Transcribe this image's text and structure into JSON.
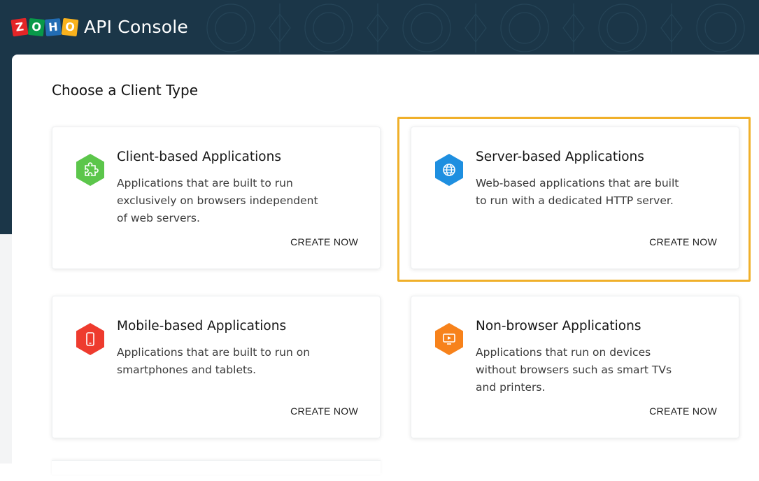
{
  "header": {
    "logo_letters": [
      "Z",
      "O",
      "H",
      "O"
    ],
    "logo_colors": [
      "#e42527",
      "#089949",
      "#226db4",
      "#f9b21d"
    ],
    "title": "API Console"
  },
  "main": {
    "section_title": "Choose a Client Type",
    "cards": [
      {
        "title": "Client-based Applications",
        "description": "Applications that are built to run exclusively on browsers independent of web servers.",
        "action": "CREATE NOW",
        "icon": "puzzle-icon",
        "color": "#5cc64b"
      },
      {
        "title": "Server-based Applications",
        "description": "Web-based applications that are built to run with a dedicated HTTP server.",
        "action": "CREATE NOW",
        "icon": "globe-icon",
        "color": "#1e8fe0",
        "highlighted": true
      },
      {
        "title": "Mobile-based Applications",
        "description": "Applications that are built to run on smartphones and tablets.",
        "action": "CREATE NOW",
        "icon": "smartphone-icon",
        "color": "#ee3b2e"
      },
      {
        "title": "Non-browser Applications",
        "description": "Applications that run on devices without browsers such as smart TVs and printers.",
        "action": "CREATE NOW",
        "icon": "tv-icon",
        "color": "#f7821b"
      }
    ]
  },
  "colors": {
    "header_bg": "#1b3648",
    "highlight": "#f0b02a"
  }
}
